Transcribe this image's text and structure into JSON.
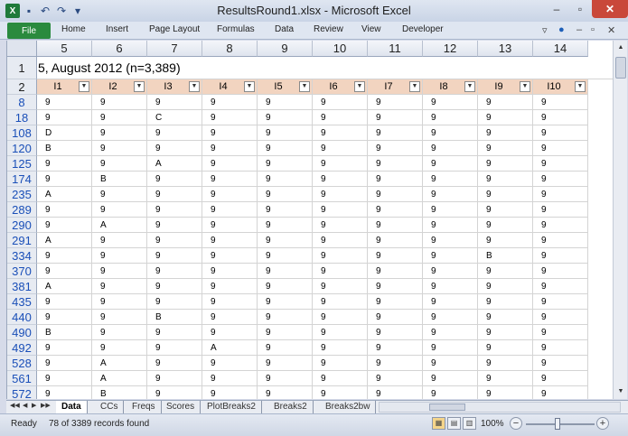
{
  "window": {
    "title": "ResultsRound1.xlsx  -  Microsoft Excel",
    "app_logo": "X"
  },
  "qat": {
    "save": "save-icon",
    "undo": "undo-icon",
    "redo": "redo-icon"
  },
  "ribbon": {
    "file_label": "File",
    "tabs": [
      "Home",
      "Insert",
      "Page Layout",
      "Formulas",
      "Data",
      "Review",
      "View",
      "Developer"
    ]
  },
  "sheet": {
    "column_headers": [
      "5",
      "6",
      "7",
      "8",
      "9",
      "10",
      "11",
      "12",
      "13",
      "14"
    ],
    "row1_number": "1",
    "row1_text": "5, August 2012 (n=3,389)",
    "row2_number": "2",
    "table_headers": [
      "I1",
      "I2",
      "I3",
      "I4",
      "I5",
      "I6",
      "I7",
      "I8",
      "I9",
      "I10"
    ],
    "filter_glyph": "▼",
    "rows": [
      {
        "num": "8",
        "cells": [
          "9",
          "9",
          "9",
          "9",
          "9",
          "9",
          "9",
          "9",
          "9",
          "9"
        ]
      },
      {
        "num": "18",
        "cells": [
          "9",
          "9",
          "C",
          "9",
          "9",
          "9",
          "9",
          "9",
          "9",
          "9"
        ]
      },
      {
        "num": "108",
        "cells": [
          "D",
          "9",
          "9",
          "9",
          "9",
          "9",
          "9",
          "9",
          "9",
          "9"
        ]
      },
      {
        "num": "120",
        "cells": [
          "B",
          "9",
          "9",
          "9",
          "9",
          "9",
          "9",
          "9",
          "9",
          "9"
        ]
      },
      {
        "num": "125",
        "cells": [
          "9",
          "9",
          "A",
          "9",
          "9",
          "9",
          "9",
          "9",
          "9",
          "9"
        ]
      },
      {
        "num": "174",
        "cells": [
          "9",
          "B",
          "9",
          "9",
          "9",
          "9",
          "9",
          "9",
          "9",
          "9"
        ]
      },
      {
        "num": "235",
        "cells": [
          "A",
          "9",
          "9",
          "9",
          "9",
          "9",
          "9",
          "9",
          "9",
          "9"
        ]
      },
      {
        "num": "289",
        "cells": [
          "9",
          "9",
          "9",
          "9",
          "9",
          "9",
          "9",
          "9",
          "9",
          "9"
        ]
      },
      {
        "num": "290",
        "cells": [
          "9",
          "A",
          "9",
          "9",
          "9",
          "9",
          "9",
          "9",
          "9",
          "9"
        ]
      },
      {
        "num": "291",
        "cells": [
          "A",
          "9",
          "9",
          "9",
          "9",
          "9",
          "9",
          "9",
          "9",
          "9"
        ]
      },
      {
        "num": "334",
        "cells": [
          "9",
          "9",
          "9",
          "9",
          "9",
          "9",
          "9",
          "9",
          "B",
          "9"
        ]
      },
      {
        "num": "370",
        "cells": [
          "9",
          "9",
          "9",
          "9",
          "9",
          "9",
          "9",
          "9",
          "9",
          "9"
        ]
      },
      {
        "num": "381",
        "cells": [
          "A",
          "9",
          "9",
          "9",
          "9",
          "9",
          "9",
          "9",
          "9",
          "9"
        ]
      },
      {
        "num": "435",
        "cells": [
          "9",
          "9",
          "9",
          "9",
          "9",
          "9",
          "9",
          "9",
          "9",
          "9"
        ]
      },
      {
        "num": "440",
        "cells": [
          "9",
          "9",
          "B",
          "9",
          "9",
          "9",
          "9",
          "9",
          "9",
          "9"
        ]
      },
      {
        "num": "490",
        "cells": [
          "B",
          "9",
          "9",
          "9",
          "9",
          "9",
          "9",
          "9",
          "9",
          "9"
        ]
      },
      {
        "num": "492",
        "cells": [
          "9",
          "9",
          "9",
          "A",
          "9",
          "9",
          "9",
          "9",
          "9",
          "9"
        ]
      },
      {
        "num": "528",
        "cells": [
          "9",
          "A",
          "9",
          "9",
          "9",
          "9",
          "9",
          "9",
          "9",
          "9"
        ]
      },
      {
        "num": "561",
        "cells": [
          "9",
          "A",
          "9",
          "9",
          "9",
          "9",
          "9",
          "9",
          "9",
          "9"
        ]
      },
      {
        "num": "572",
        "cells": [
          "9",
          "B",
          "9",
          "9",
          "9",
          "9",
          "9",
          "9",
          "9",
          "9"
        ]
      }
    ]
  },
  "sheet_tabs": [
    "Data",
    "CCs",
    "Freqs",
    "Scores",
    "PlotBreaks2",
    "Breaks2",
    "Breaks2bw"
  ],
  "active_tab": "Data",
  "status": {
    "mode": "Ready",
    "records": "78 of 3389 records found",
    "zoom": "100%",
    "zoom_minus": "−",
    "zoom_plus": "+"
  },
  "colors": {
    "header_fill": "#f2d4c0",
    "row_link": "#1a4fb8",
    "file_tab": "#2a8a3e"
  }
}
